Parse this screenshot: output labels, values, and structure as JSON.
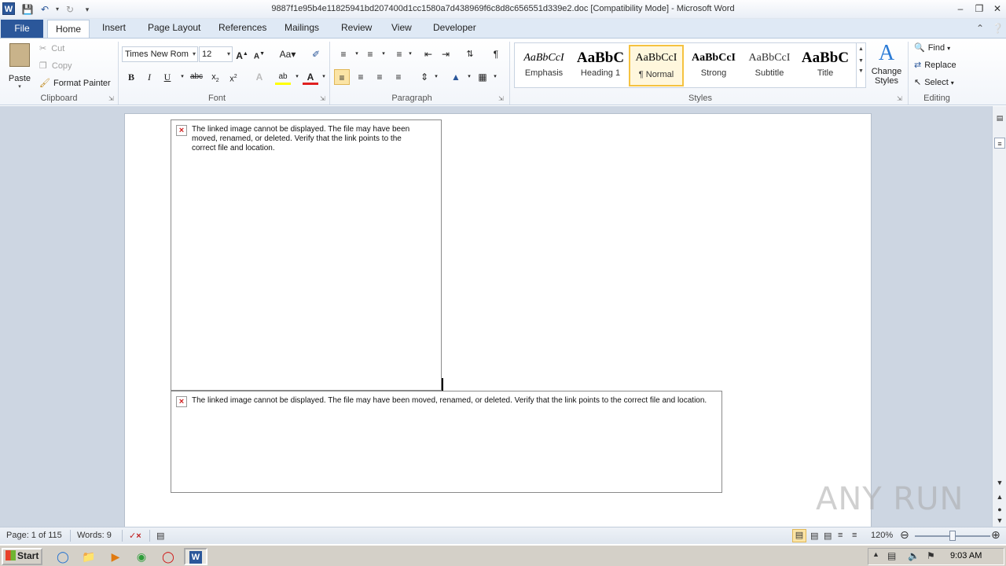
{
  "window": {
    "title": "9887f1e95b4e11825941bd207400d1cc1580a7d438969f6c8d8c656551d339e2.doc [Compatibility Mode]  -  Microsoft Word",
    "app_icon": "W"
  },
  "tabs": [
    "File",
    "Home",
    "Insert",
    "Page Layout",
    "References",
    "Mailings",
    "Review",
    "View",
    "Developer"
  ],
  "clipboard": {
    "paste": "Paste",
    "cut": "Cut",
    "copy": "Copy",
    "format_painter": "Format Painter",
    "label": "Clipboard"
  },
  "font": {
    "name": "Times New Rom",
    "size": "12",
    "label": "Font"
  },
  "paragraph": {
    "label": "Paragraph"
  },
  "styles": {
    "items": [
      {
        "preview": "AaBbCcI",
        "name": "Emphasis"
      },
      {
        "preview": "AaBbC",
        "name": "Heading 1"
      },
      {
        "preview": "AaBbCcI",
        "name": "¶ Normal"
      },
      {
        "preview": "AaBbCcI",
        "name": "Strong"
      },
      {
        "preview": "AaBbCcI",
        "name": "Subtitle"
      },
      {
        "preview": "AaBbC",
        "name": "Title"
      }
    ],
    "change_styles": "Change Styles",
    "label": "Styles"
  },
  "editing": {
    "find": "Find",
    "replace": "Replace",
    "select": "Select",
    "label": "Editing"
  },
  "document": {
    "image1_message": "The linked image cannot be displayed.  The file may have been moved, renamed, or deleted. Verify that the link points to the correct file and location.",
    "image2_message": "The linked image cannot be displayed.  The file may have been moved, renamed, or deleted. Verify that the link points to the correct file and location."
  },
  "status": {
    "page": "Page: 1 of 115",
    "words": "Words: 9",
    "zoom": "120%"
  },
  "taskbar": {
    "start": "Start",
    "time": "9:03 AM"
  },
  "watermark": "ANY RUN",
  "colors": {
    "word_blue": "#2b579a",
    "ribbon_bg": "#f2f5fa",
    "workspace_bg": "#cdd6e2",
    "selected_style": "#f5c240"
  }
}
